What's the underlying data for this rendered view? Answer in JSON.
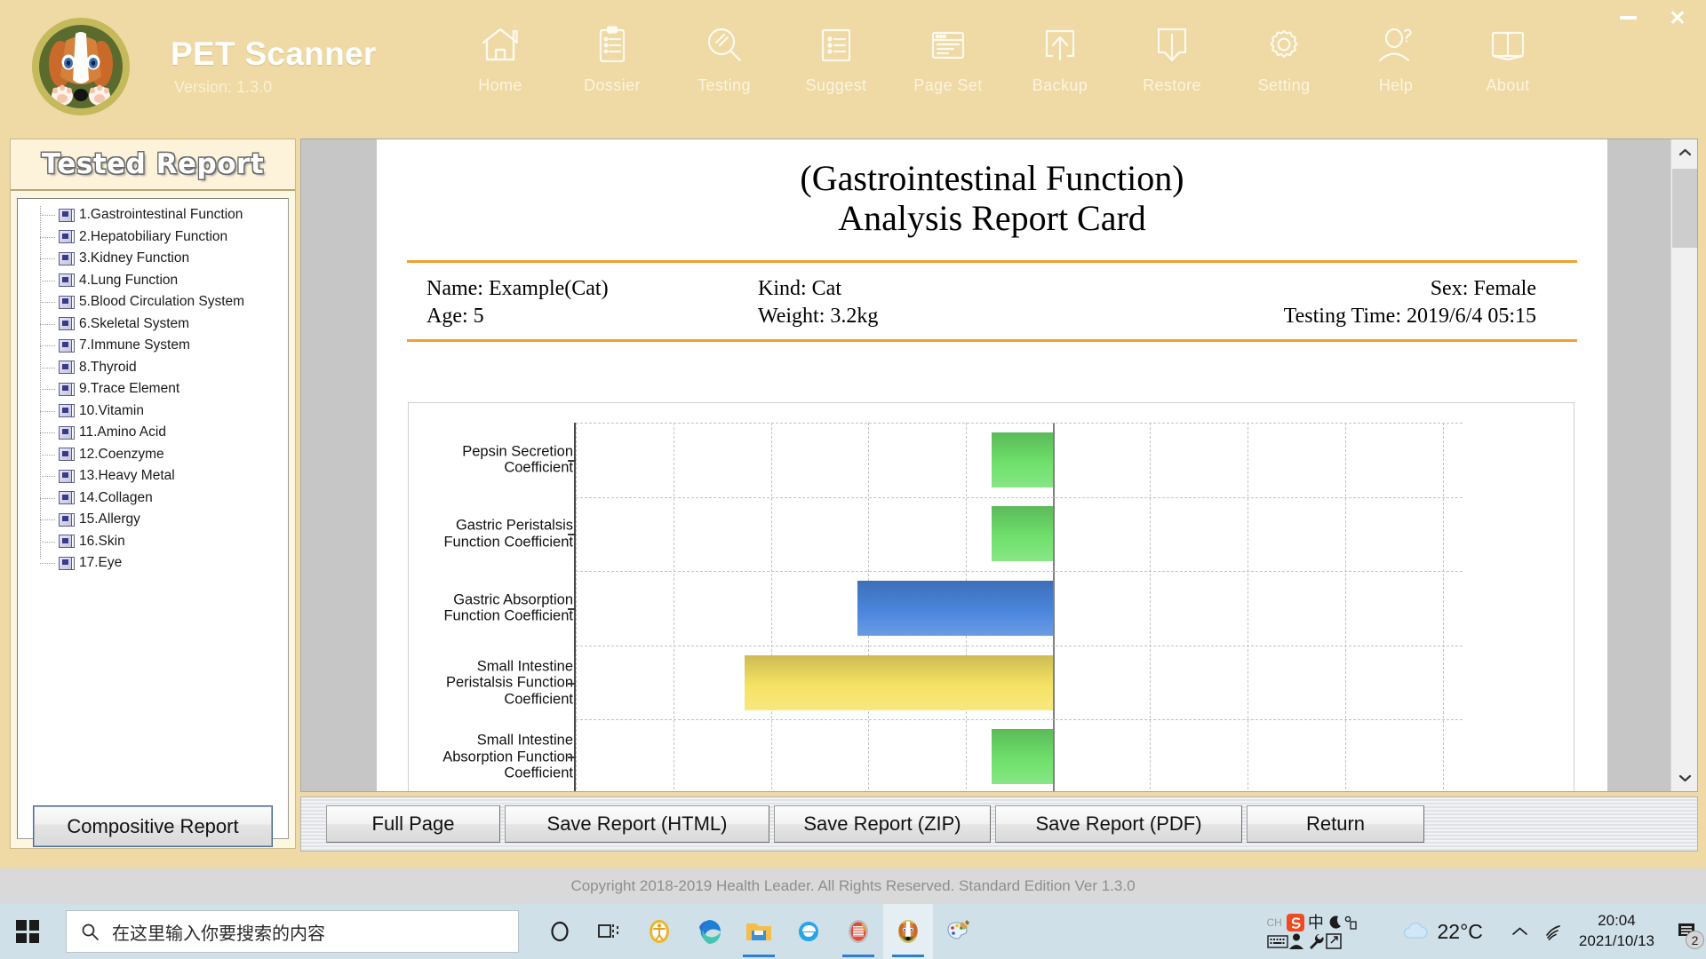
{
  "window": {
    "app_title": "PET Scanner",
    "version_label": "Version: 1.3.0",
    "minimize_label": "",
    "close_label": "✕",
    "logo_icon": "dog-face-logo"
  },
  "nav": {
    "items": [
      {
        "label": "Home",
        "icon": "home-icon"
      },
      {
        "label": "Dossier",
        "icon": "clipboard-icon"
      },
      {
        "label": "Testing",
        "icon": "magnifier-icon"
      },
      {
        "label": "Suggest",
        "icon": "list-icon"
      },
      {
        "label": "Page Set",
        "icon": "browser-window-icon"
      },
      {
        "label": "Backup",
        "icon": "upload-box-icon"
      },
      {
        "label": "Restore",
        "icon": "download-box-icon"
      },
      {
        "label": "Setting",
        "icon": "gear-icon"
      },
      {
        "label": "Help",
        "icon": "person-question-icon"
      },
      {
        "label": "About",
        "icon": "open-book-icon"
      }
    ]
  },
  "sidebar": {
    "title": "Tested Report",
    "items": [
      "1.Gastrointestinal Function",
      "2.Hepatobiliary Function",
      "3.Kidney Function",
      "4.Lung Function",
      "5.Blood Circulation System",
      "6.Skeletal System",
      "7.Immune System",
      "8.Thyroid",
      "9.Trace Element",
      "10.Vitamin",
      "11.Amino Acid",
      "12.Coenzyme",
      "13.Heavy Metal",
      "14.Collagen",
      "15.Allergy",
      "16.Skin",
      "17.Eye"
    ],
    "composite_button": "Compositive Report"
  },
  "report": {
    "title_line1": "(Gastrointestinal Function)",
    "title_line2": "Analysis Report Card",
    "meta": {
      "name": "Name: Example(Cat)",
      "kind": "Kind: Cat",
      "sex": "Sex: Female",
      "age": "Age: 5",
      "weight": "Weight: 3.2kg",
      "testing_time": "Testing Time: 2019/6/4 05:15"
    },
    "scroll_up_icon": "chevron-up-icon",
    "scroll_down_icon": "chevron-down-icon"
  },
  "chart_data": {
    "type": "bar",
    "orientation": "horizontal",
    "title": "",
    "xlabel": "",
    "ylabel": "",
    "grid": true,
    "legend": "none",
    "zero_line_x": 0,
    "xlim": [
      -2.2,
      1.9
    ],
    "categories": [
      "Pepsin Secretion Coefficient",
      "Gastric Peristalsis Function Coefficient",
      "Gastric Absorption Function Coefficient",
      "Small Intestine Peristalsis Function Coefficient",
      "Small Intestine Absorption Function Coefficient"
    ],
    "values": [
      -0.28,
      -0.28,
      -0.9,
      -1.42,
      -0.28
    ],
    "colors": [
      "#6ee06b",
      "#6ee06b",
      "#4a86dd",
      "#f6e264",
      "#6ee06b"
    ],
    "xticks": [
      -2.2,
      -1.75,
      -1.3,
      -0.85,
      -0.4,
      0,
      0.45,
      0.9,
      1.35,
      1.8
    ],
    "note": "Bars extend leftward from the solid zero axis; dashed gridlines both directions."
  },
  "buttons": {
    "full_page": "Full Page",
    "save_html": "Save Report (HTML)",
    "save_zip": "Save Report (ZIP)",
    "save_pdf": "Save Report (PDF)",
    "return": "Return"
  },
  "footer": {
    "copyright": "Copyright 2018-2019 Health Leader. All Rights Reserved.  Standard Edition Ver 1.3.0"
  },
  "taskbar": {
    "start_icon": "windows-start-icon",
    "search_placeholder": "在这里输入你要搜索的内容",
    "search_icon": "search-icon",
    "items": [
      {
        "icon": "cortana-circle-icon",
        "active": false,
        "running": false
      },
      {
        "icon": "task-view-icon",
        "active": false,
        "running": false
      },
      {
        "icon": "accessibility-icon",
        "active": false,
        "running": false
      },
      {
        "icon": "edge-browser-icon",
        "active": false,
        "running": false
      },
      {
        "icon": "file-explorer-icon",
        "active": false,
        "running": true
      },
      {
        "icon": "ie-browser-icon",
        "active": false,
        "running": false
      },
      {
        "icon": "red-scanner-app-icon",
        "active": false,
        "running": true
      },
      {
        "icon": "pet-scanner-app-icon",
        "active": true,
        "running": true
      },
      {
        "icon": "paint-icon",
        "active": false,
        "running": false
      }
    ],
    "ime": {
      "lang_tag": "CH",
      "sogou_icon": "sogou-ime-icon",
      "chinese_char": "中",
      "moon_icon": "moon-icon",
      "degree_icon": "degree-icon",
      "keyboard_icon": "keyboard-icon",
      "person_icon": "person-icon",
      "wrench_icon": "wrench-icon",
      "share_icon": "share-box-icon"
    },
    "weather": {
      "icon": "cloud-icon",
      "temperature": "22°C"
    },
    "chevron_icon": "chevron-up-icon",
    "network_icon": "wifi-icon",
    "time": "20:04",
    "date": "2021/10/13",
    "notification_icon": "notification-icon",
    "notification_count": "2"
  }
}
